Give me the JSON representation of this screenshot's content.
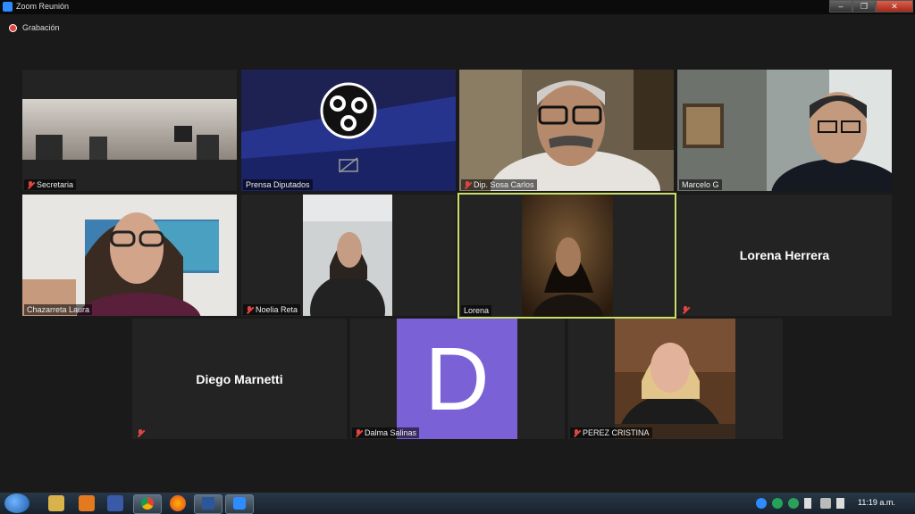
{
  "window": {
    "title": "Zoom Reunión",
    "minimize": "–",
    "maximize": "❐",
    "close": "✕"
  },
  "recording": {
    "label": "Grabación"
  },
  "participants": [
    {
      "name": "Secretaria"
    },
    {
      "name": "Prensa Diputados"
    },
    {
      "name": "Dip. Sosa Carlos"
    },
    {
      "name": "Marcelo G"
    },
    {
      "name": "Chazarreta Laura"
    },
    {
      "name": "Noelia Reta"
    },
    {
      "name": "Lorena"
    },
    {
      "name": "Lorena Herrera",
      "display": "Lorena Herrera"
    },
    {
      "name": "Diego Marnetti",
      "display": "Diego Marnetti"
    },
    {
      "name": "Dalma Salinas",
      "avatar_letter": "D",
      "avatar_color": "#7b61d6"
    },
    {
      "name": "PEREZ CRISTINA"
    }
  ],
  "active_speaker_color": "#c8e06a",
  "taskbar": {
    "time": "11:19 a.m."
  }
}
